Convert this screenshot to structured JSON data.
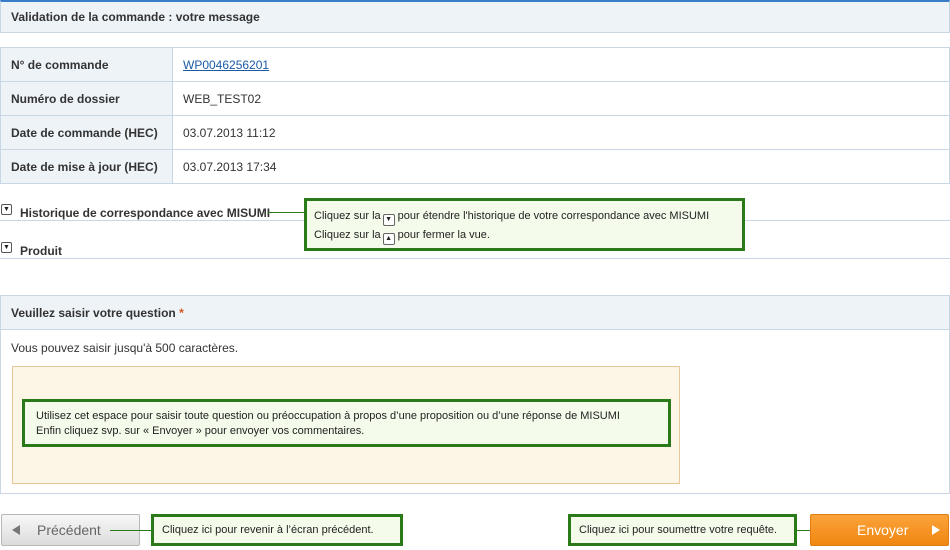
{
  "header": {
    "title": "Validation de la commande : votre message"
  },
  "order_table": {
    "rows": [
      {
        "label": "N° de commande",
        "value": "WP0046256201"
      },
      {
        "label": "Numéro de dossier",
        "value": "WEB_TEST02"
      },
      {
        "label": "Date de commande (HEC)",
        "value": "03.07.2013 11:12"
      },
      {
        "label": "Date de mise à jour (HEC)",
        "value": "03.07.2013 17:34"
      }
    ]
  },
  "sections": {
    "history": {
      "label": "Historique de correspondance avec MISUMI",
      "toggle_glyph": "▼"
    },
    "product": {
      "label": "Produit",
      "toggle_glyph": "▼"
    }
  },
  "callouts": {
    "history": {
      "line1_prefix": "Cliquez sur la",
      "line1_icon": "▼",
      "line1_suffix": "pour étendre l'historique de votre correspondance avec MISUMI",
      "line2_prefix": "Cliquez sur la",
      "line2_icon": "▲",
      "line2_suffix": "pour fermer la vue."
    },
    "textarea": {
      "line1": "Utilisez cet espace pour saisir toute question ou préoccupation à propos d’une proposition ou d’une réponse de MISUMI",
      "line2": "Enfin cliquez svp. sur « Envoyer » pour envoyer vos commentaires."
    },
    "back": "Cliquez ici pour revenir à l’écran précédent.",
    "send": "Cliquez ici pour soumettre votre requête."
  },
  "question": {
    "title": "Veuillez saisir votre question",
    "required_mark": "*",
    "char_limit": "Vous pouvez saisir jusqu'à 500 caractères."
  },
  "buttons": {
    "previous": "Précédent",
    "send": "Envoyer"
  },
  "colors": {
    "accent": "#3a7ec8",
    "callout_border": "#2a7a1a",
    "send_button": "#f08712",
    "textarea_bg": "#fdf6e6"
  }
}
